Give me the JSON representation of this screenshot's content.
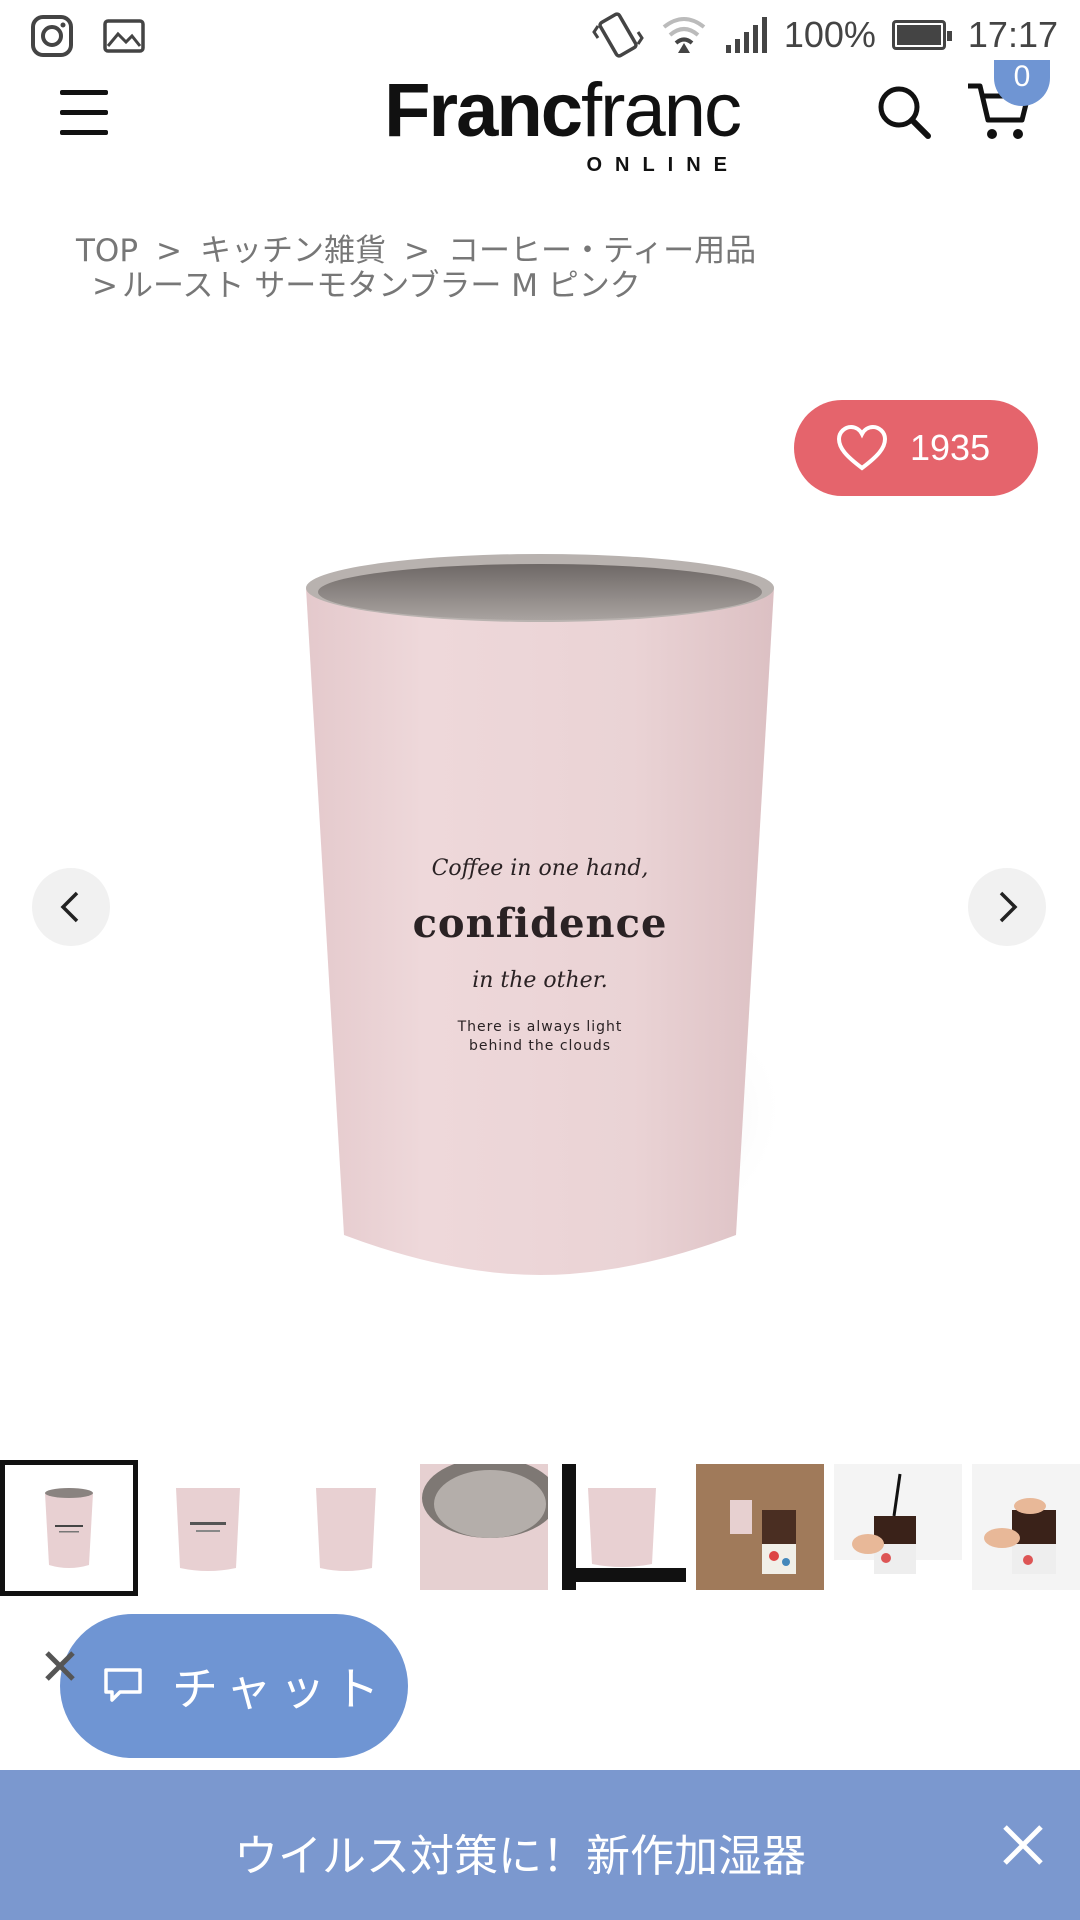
{
  "status_bar": {
    "left_icons": [
      "instagram-icon",
      "gallery-icon"
    ],
    "right_icons": [
      "vibrate-icon",
      "wifi-icon",
      "signal-icon",
      "battery-icon"
    ],
    "battery_percent": "100%",
    "battery_level": 1.0,
    "time": "17:17"
  },
  "header": {
    "logo_bold": "Franc",
    "logo_thin": "franc",
    "logo_sub": "ONLINE",
    "cart_count": "0",
    "icons": [
      "menu-icon",
      "search-icon",
      "cart-icon"
    ]
  },
  "breadcrumb": {
    "items": [
      "TOP",
      "キッチン雑貨",
      "コーヒー・ティー用品",
      "ルースト サーモタンブラー M ピンク"
    ],
    "separator": ">"
  },
  "like": {
    "count": "1935",
    "icon": "heart-icon",
    "color": "#e5646c"
  },
  "product_image": {
    "text_line1": "Coffee in one hand,",
    "text_line2": "confidence",
    "text_line3": "in the other.",
    "text_line4": "There is always light",
    "text_line5": "behind the clouds",
    "cup_color": "#ecd6d8",
    "prev_icon": "chevron-left-icon",
    "next_icon": "chevron-right-icon"
  },
  "thumbnails": {
    "count": 8,
    "selected_index": 0
  },
  "chat": {
    "label": "チャット",
    "icon": "chat-bubble-icon",
    "close_icon": "close-icon",
    "color": "#6f95d3"
  },
  "banner": {
    "text": "ウイルス対策に！新作加湿器",
    "close_icon": "close-icon",
    "color": "#7b98cf"
  }
}
